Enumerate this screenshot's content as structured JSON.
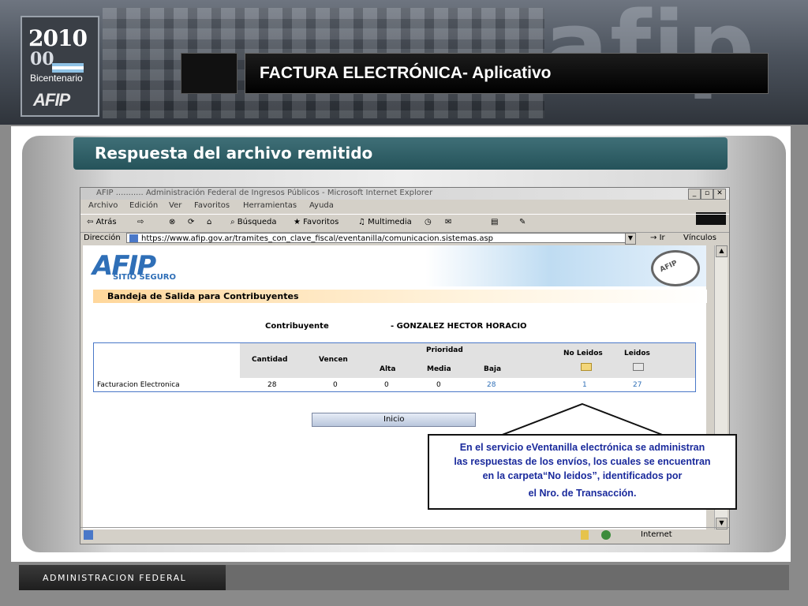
{
  "banner": {
    "logo_year": "2010",
    "logo_sub": "00",
    "logo_caption": "Bicentenario",
    "logo_brand": "AFIP",
    "background_word": "afip",
    "title": "FACTURA ELECTRÓNICA- Aplicativo"
  },
  "section": {
    "title": "Respuesta del archivo remitido"
  },
  "browser": {
    "window_title": "AFIP ........... Administración Federal de Ingresos Públicos - Microsoft Internet Explorer",
    "menu": [
      "Archivo",
      "Edición",
      "Ver",
      "Favoritos",
      "Herramientas",
      "Ayuda"
    ],
    "toolbar": [
      "Atrás",
      "Búsqueda",
      "Favoritos",
      "Multimedia"
    ],
    "address_label": "Dirección",
    "address_url": "https://www.afip.gov.ar/tramites_con_clave_fiscal/eventanilla/comunicacion.sistemas.asp",
    "go_label": "Ir",
    "links_label": "Vínculos",
    "status_zone": "Internet"
  },
  "page": {
    "logo": "AFIP",
    "logo_sub": "SITIO SEGURO",
    "seal_text": "AFIP",
    "heading": "Bandeja de Salida para Contribuyentes",
    "contrib_label": "Contribuyente",
    "contrib_name": "- GONZALEZ HECTOR HORACIO",
    "table": {
      "headers": {
        "cantidad": "Cantidad",
        "vencen": "Vencen",
        "prioridad": "Prioridad",
        "alta": "Alta",
        "media": "Media",
        "baja": "Baja",
        "no_leidos": "No Leidos",
        "leidos": "Leidos"
      },
      "row": {
        "name": "Facturacion Electronica",
        "cantidad": "28",
        "vencen": "0",
        "alta": "0",
        "media": "0",
        "baja": "28",
        "no_leidos": "1",
        "leidos": "27"
      }
    },
    "inicio_button": "Inicio"
  },
  "callout": {
    "line1": "En el servicio eVentanilla electrónica se administran",
    "line2": "las respuestas de los envíos, los cuales se encuentran",
    "line3": "en la carpeta“No leidos”, identificados por",
    "line4": "el Nro. de Transacción."
  },
  "footer": {
    "label": "ADMINISTRACION FEDERAL"
  },
  "colors": {
    "section_bg": "#2f5f66",
    "callout_text": "#1a2a9c",
    "link_blue": "#2f6fb7"
  }
}
